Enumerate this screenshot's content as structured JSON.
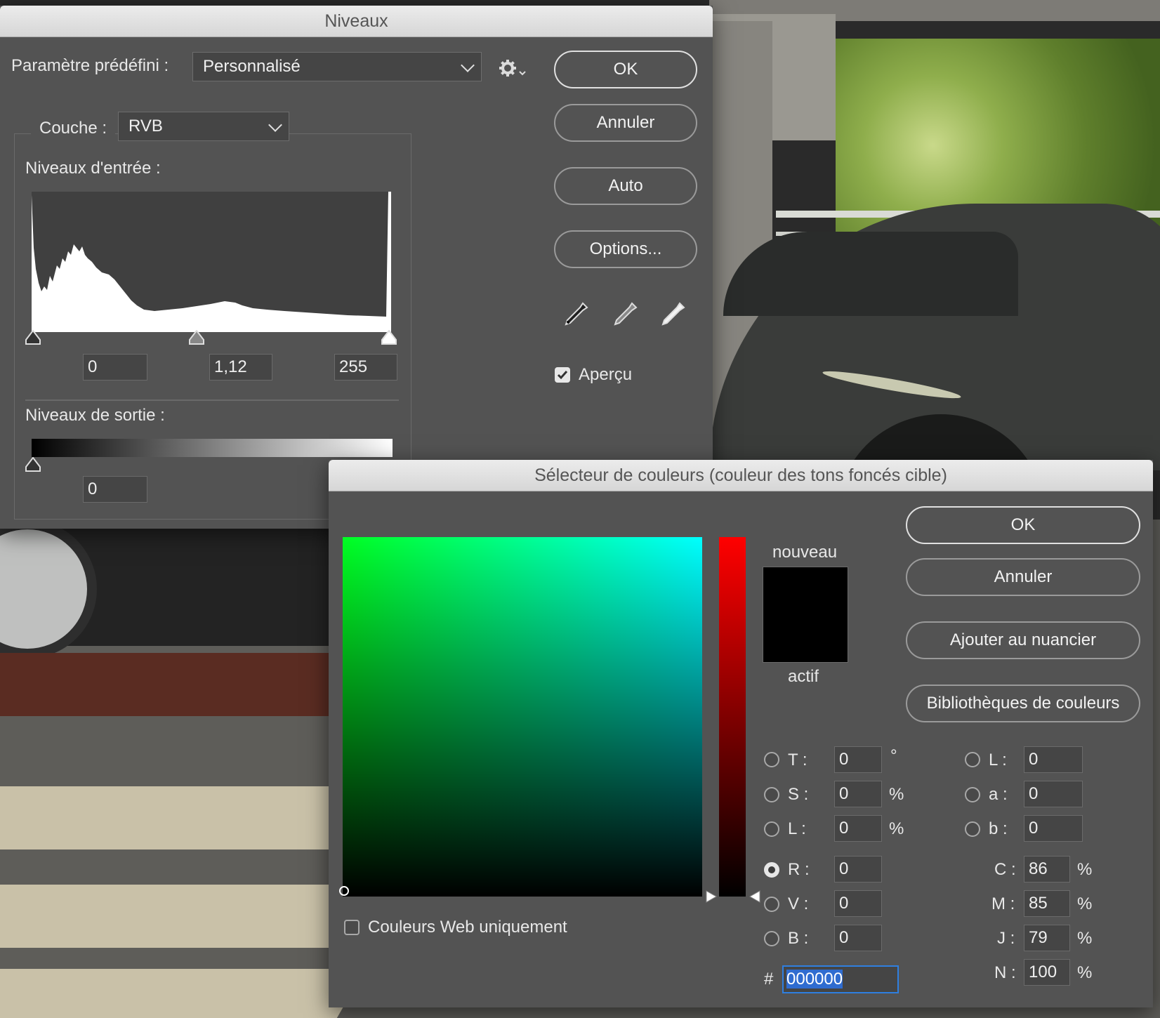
{
  "levels": {
    "title": "Niveaux",
    "preset_label": "Paramètre prédéfini :",
    "preset_value": "Personnalisé",
    "channel_label": "Couche :",
    "channel_value": "RVB",
    "input_levels_label": "Niveaux d'entrée :",
    "input_black": "0",
    "input_gamma": "1,12",
    "input_white": "255",
    "output_levels_label": "Niveaux de sortie :",
    "output_black": "0",
    "buttons": {
      "ok": "OK",
      "cancel": "Annuler",
      "auto": "Auto",
      "options": "Options..."
    },
    "preview_label": "Aperçu",
    "preview_checked": true
  },
  "picker": {
    "title": "Sélecteur de couleurs (couleur des tons foncés cible)",
    "new_label": "nouveau",
    "current_label": "actif",
    "buttons": {
      "ok": "OK",
      "cancel": "Annuler",
      "add_swatch": "Ajouter au nuancier",
      "libraries": "Bibliothèques de couleurs"
    },
    "web_only_label": "Couleurs Web uniquement",
    "hsb": [
      {
        "label": "T :",
        "value": "0",
        "unit": "°"
      },
      {
        "label": "S :",
        "value": "0",
        "unit": "%"
      },
      {
        "label": "L :",
        "value": "0",
        "unit": "%"
      }
    ],
    "rgb": [
      {
        "label": "R :",
        "value": "0"
      },
      {
        "label": "V :",
        "value": "0"
      },
      {
        "label": "B :",
        "value": "0"
      }
    ],
    "lab": [
      {
        "label": "L :",
        "value": "0"
      },
      {
        "label": "a :",
        "value": "0"
      },
      {
        "label": "b :",
        "value": "0"
      }
    ],
    "cmyk": [
      {
        "label": "C :",
        "value": "86",
        "unit": "%"
      },
      {
        "label": "M :",
        "value": "85",
        "unit": "%"
      },
      {
        "label": "J :",
        "value": "79",
        "unit": "%"
      },
      {
        "label": "N :",
        "value": "100",
        "unit": "%"
      }
    ],
    "hex_prefix": "#",
    "hex_value": "000000",
    "selected_mode": "R",
    "new_color": "#000000"
  }
}
